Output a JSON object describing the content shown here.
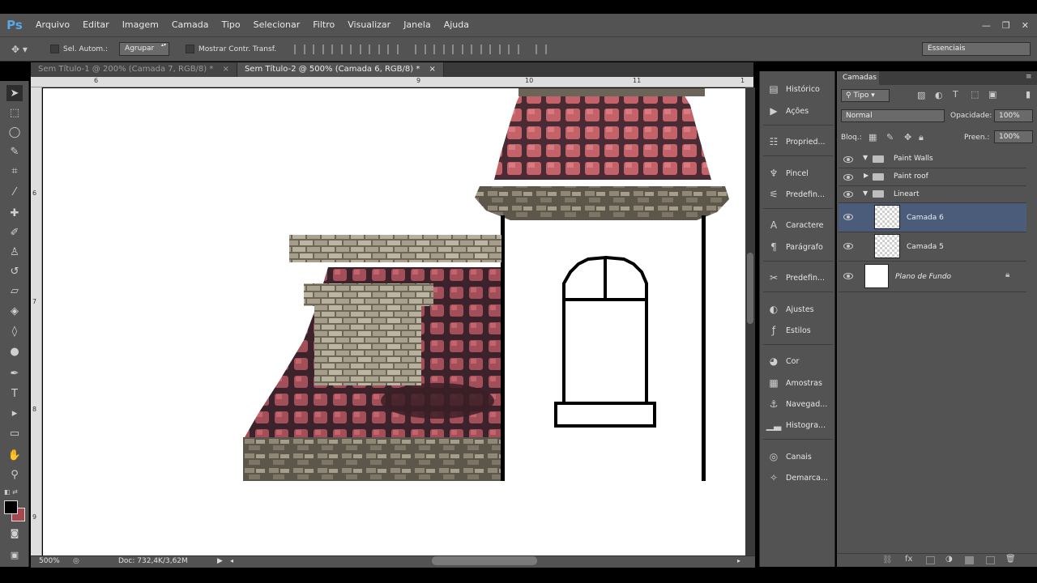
{
  "app": {
    "logo": "Ps"
  },
  "menu": [
    "Arquivo",
    "Editar",
    "Imagem",
    "Camada",
    "Tipo",
    "Selecionar",
    "Filtro",
    "Visualizar",
    "Janela",
    "Ajuda"
  ],
  "window_controls": {
    "minimize": "—",
    "restore": "❐",
    "close": "✕"
  },
  "options_bar": {
    "auto_select_label": "Sel. Autom.:",
    "auto_select_value": "Agrupar",
    "transform_label": "Mostrar Contr. Transf."
  },
  "workspace": "Essenciais",
  "tabs": [
    {
      "label": "Sem Título-1 @ 200% (Camada 7, RGB/8) *",
      "close": "×"
    },
    {
      "label": "Sem Título-2 @ 500% (Camada 6, RGB/8) *",
      "close": "×"
    }
  ],
  "rulers": {
    "top": [
      "6",
      "9",
      "10",
      "11",
      "1"
    ],
    "left": [
      "6",
      "7",
      "8",
      "9"
    ]
  },
  "status": {
    "zoom": "500%",
    "doc": "Doc: 732,4K/3,62M"
  },
  "dock": [
    {
      "label": "Histórico",
      "icon": "history-icon"
    },
    {
      "label": "Ações",
      "icon": "play-icon"
    },
    {
      "label": "Propried...",
      "icon": "properties-icon"
    },
    {
      "label": "Pincel",
      "icon": "brush-icon"
    },
    {
      "label": "Predefin...",
      "icon": "brush-presets-icon"
    },
    {
      "label": "Caractere",
      "icon": "character-icon"
    },
    {
      "label": "Parágrafo",
      "icon": "paragraph-icon"
    },
    {
      "label": "Predefin...",
      "icon": "tool-presets-icon"
    },
    {
      "label": "Ajustes",
      "icon": "adjustments-icon"
    },
    {
      "label": "Estilos",
      "icon": "styles-icon"
    },
    {
      "label": "Cor",
      "icon": "color-icon"
    },
    {
      "label": "Amostras",
      "icon": "swatches-icon"
    },
    {
      "label": "Navegad...",
      "icon": "navigator-icon"
    },
    {
      "label": "Histogra...",
      "icon": "histogram-icon"
    },
    {
      "label": "Canais",
      "icon": "channels-icon"
    },
    {
      "label": "Demarca...",
      "icon": "paths-icon"
    }
  ],
  "layers_panel": {
    "tab": "Camadas",
    "filter": "Tipo",
    "blend_mode": "Normal",
    "opacity_label": "Opacidade:",
    "opacity": "100%",
    "lock_label": "Bloq.:",
    "fill_label": "Preen.:",
    "fill": "100%",
    "layers": [
      {
        "name": "Paint Walls",
        "type": "group",
        "expanded": true
      },
      {
        "name": "Paint roof",
        "type": "group",
        "expanded": false
      },
      {
        "name": "Lineart",
        "type": "group",
        "expanded": true
      },
      {
        "name": "Camada 6",
        "type": "layer",
        "selected": true
      },
      {
        "name": "Camada 5",
        "type": "layer"
      },
      {
        "name": "Plano de Fundo",
        "type": "background",
        "locked": true
      }
    ]
  },
  "colors": {
    "foreground": "#000000",
    "background": "#a5484f",
    "roof": "#a45a65",
    "stone": "#9b9583",
    "selection": "#4b5b7a"
  }
}
